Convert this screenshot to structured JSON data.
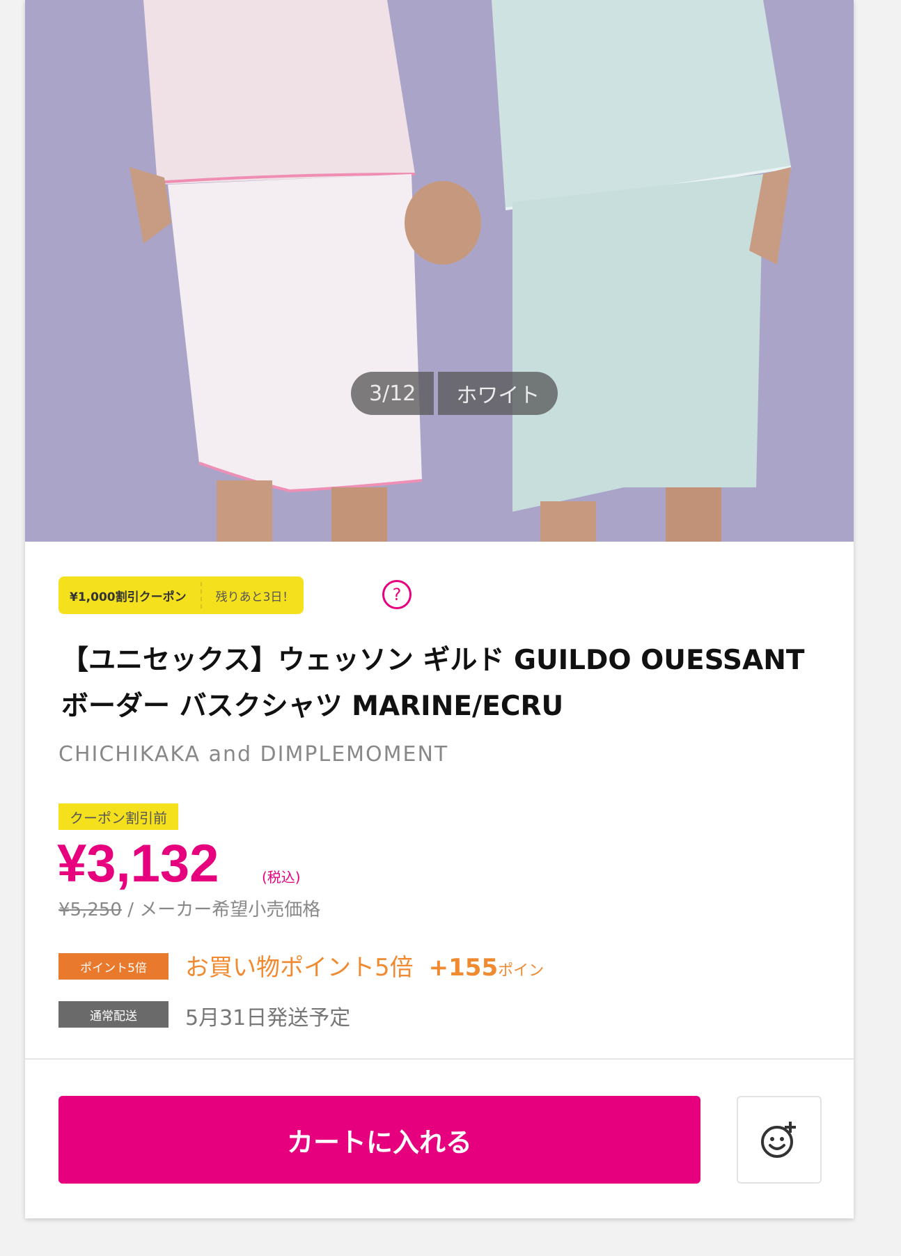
{
  "gallery": {
    "counter": "3/12",
    "color_label": "ホワイト"
  },
  "coupon": {
    "discount_label": "¥1,000割引クーポン",
    "remaining_label": "残りあと3日！",
    "help_glyph": "?"
  },
  "product": {
    "title": "【ユニセックス】ウェッソン ギルド GUILDO OUESSANT ボーダー バスクシャツ MARINE/ECRU",
    "brand": "CHICHIKAKA and DIMPLEMOMENT"
  },
  "pricing": {
    "pre_coupon_label": "クーポン割引前",
    "price": "¥3,132",
    "tax_label": "(税込)",
    "list_price": "¥5,250",
    "list_price_suffix": " / メーカー希望小売価格"
  },
  "points": {
    "tag": "ポイント5倍",
    "text": "お買い物ポイント5倍",
    "plus": "+155",
    "unit": "ポイン"
  },
  "shipping": {
    "tag": "通常配送",
    "text": "5月31日発送予定"
  },
  "actions": {
    "cart_label": "カートに入れる",
    "favorite_icon": "smile-plus-icon"
  },
  "colors": {
    "accent": "#e6007e",
    "coupon_yellow": "#f5e01d",
    "points_orange": "#e97a2d",
    "photo_bg": "#a9a4c6"
  }
}
